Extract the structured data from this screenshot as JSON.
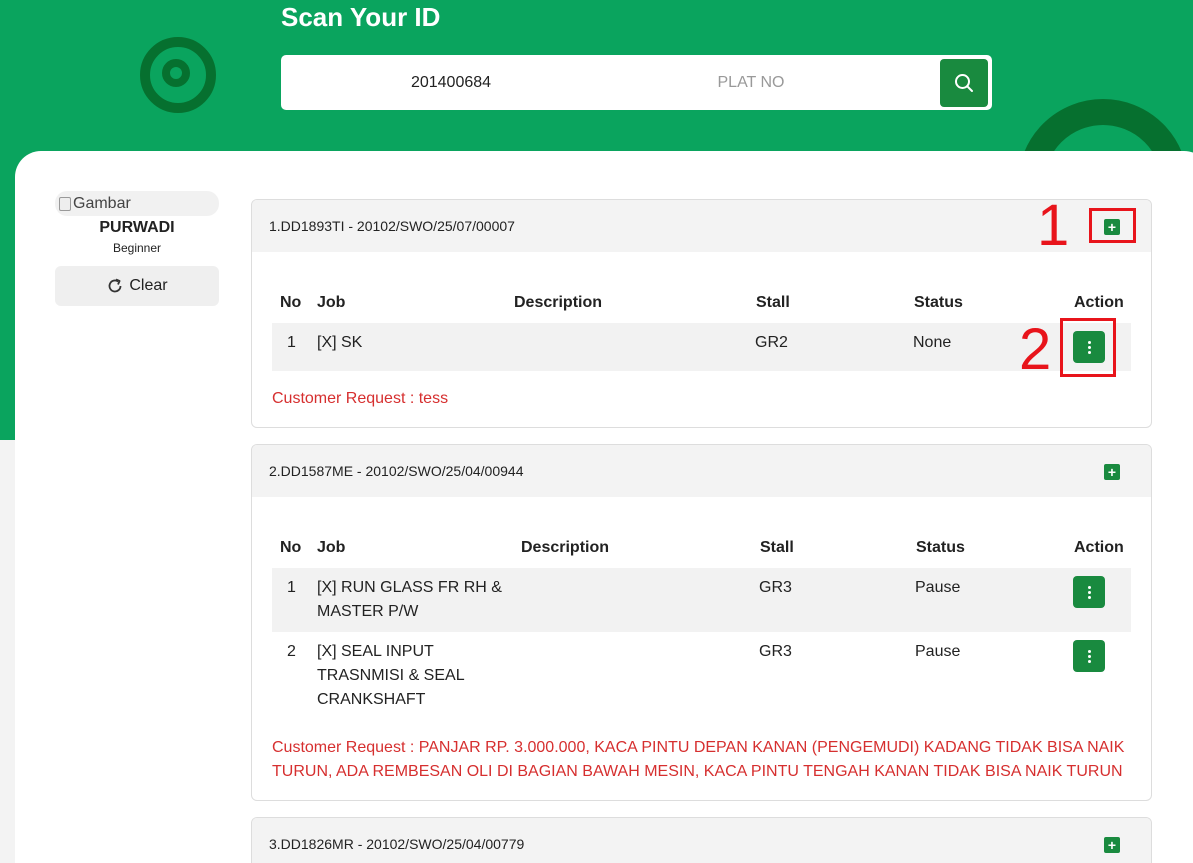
{
  "header": {
    "title": "Scan Your ID",
    "id_value": "201400684",
    "plat_placeholder": "PLAT NO"
  },
  "user": {
    "avatar_alt": "Gambar",
    "name": "PURWADI",
    "level": "Beginner",
    "clear_label": "Clear"
  },
  "table_headers": {
    "no": "No",
    "job": "Job",
    "description": "Description",
    "stall": "Stall",
    "status": "Status",
    "action": "Action"
  },
  "work_orders": [
    {
      "title": "1.DD1893TI - 20102/SWO/25/07/00007",
      "rows": [
        {
          "no": "1",
          "job": "[X] SK",
          "description": "",
          "stall": "GR2",
          "status": "None"
        }
      ],
      "customer_request": "Customer Request : tess"
    },
    {
      "title": "2.DD1587ME - 20102/SWO/25/04/00944",
      "rows": [
        {
          "no": "1",
          "job_lines": [
            "[X] RUN GLASS FR RH &",
            "MASTER P/W"
          ],
          "description": "",
          "stall": "GR3",
          "status": "Pause"
        },
        {
          "no": "2",
          "job_lines": [
            "[X] SEAL INPUT",
            "TRASNMISI & SEAL",
            "CRANKSHAFT"
          ],
          "description": "",
          "stall": "GR3",
          "status": "Pause"
        }
      ],
      "customer_request_lines": [
        "Customer Request : PANJAR RP. 3.000.000, KACA PINTU DEPAN KANAN (PENGEMUDI) KADANG TIDAK BISA NAIK",
        "TURUN, ADA REMBESAN OLI DI BAGIAN BAWAH MESIN, KACA PINTU TENGAH KANAN TIDAK BISA NAIK TURUN"
      ]
    },
    {
      "title": "3.DD1826MR - 20102/SWO/25/04/00779"
    }
  ],
  "annotations": [
    "1",
    "2"
  ],
  "colors": {
    "brand_green": "#0aa45e",
    "dark_green": "#06702f",
    "button_green": "#198a3f",
    "request_red": "#d62f2f",
    "annotation_red": "#e8141b"
  }
}
